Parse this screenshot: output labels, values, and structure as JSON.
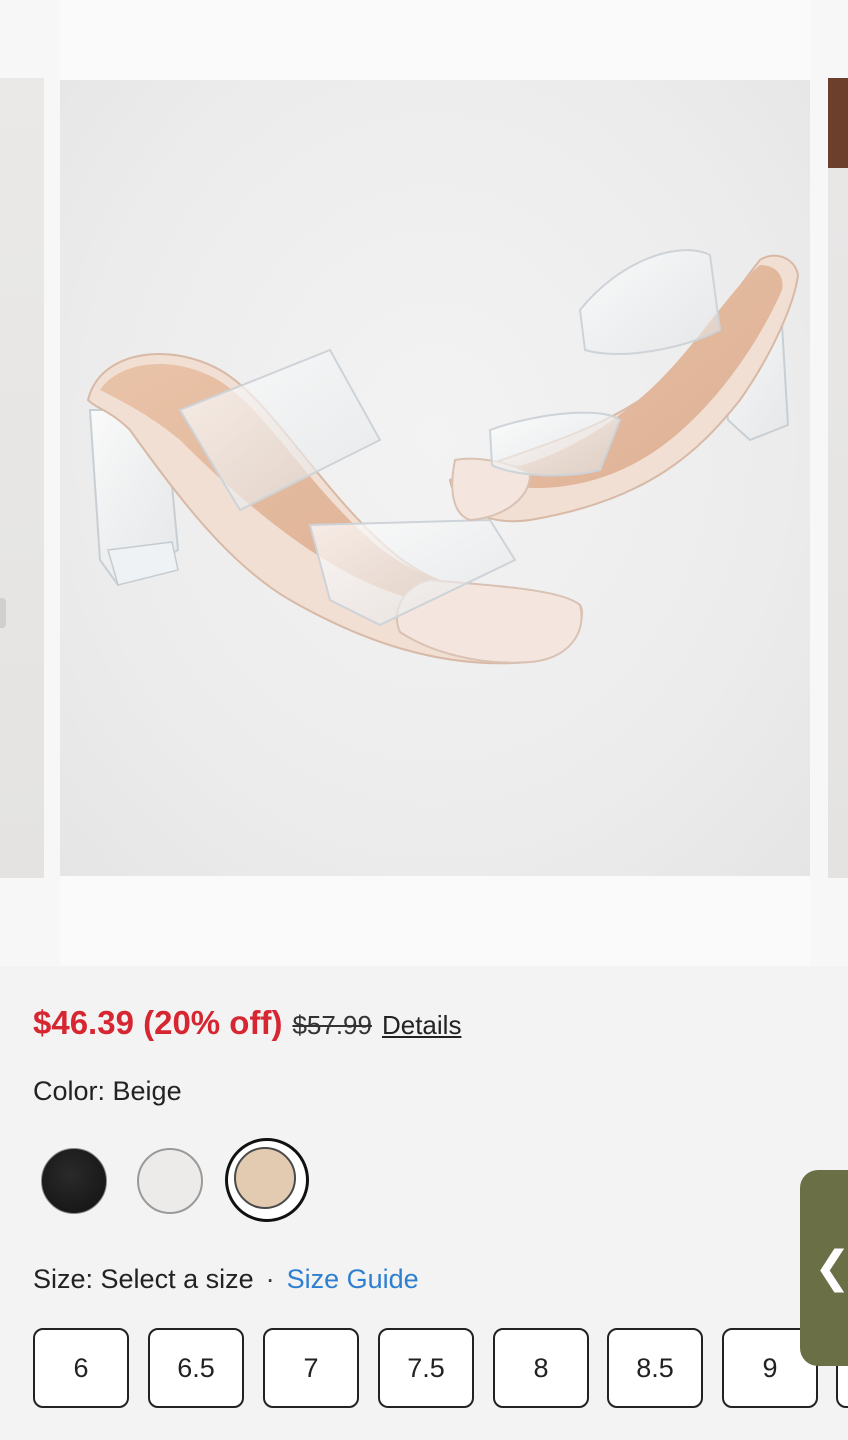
{
  "gallery": {
    "image_alt": "Clear strap block heel sandals"
  },
  "product": {
    "sale_price": "$46.39 (20% off)",
    "original_price": "$57.99",
    "details_link": "Details",
    "color_label": "Color: Beige",
    "swatches": [
      {
        "name": "Black",
        "hex": "#151515"
      },
      {
        "name": "White",
        "hex": "#ecebea"
      },
      {
        "name": "Beige",
        "hex": "#e3cbb1",
        "selected": true
      }
    ],
    "size_label": "Size: Select a size",
    "size_separator": "·",
    "size_guide": "Size Guide",
    "sizes": [
      "6",
      "6.5",
      "7",
      "7.5",
      "8",
      "8.5",
      "9"
    ]
  },
  "side_tab": {
    "icon": "chevron-left-icon",
    "glyph": "❮",
    "color": "#6b6f45"
  },
  "colors": {
    "sale": "#d62631",
    "link": "#2f7fd0"
  }
}
